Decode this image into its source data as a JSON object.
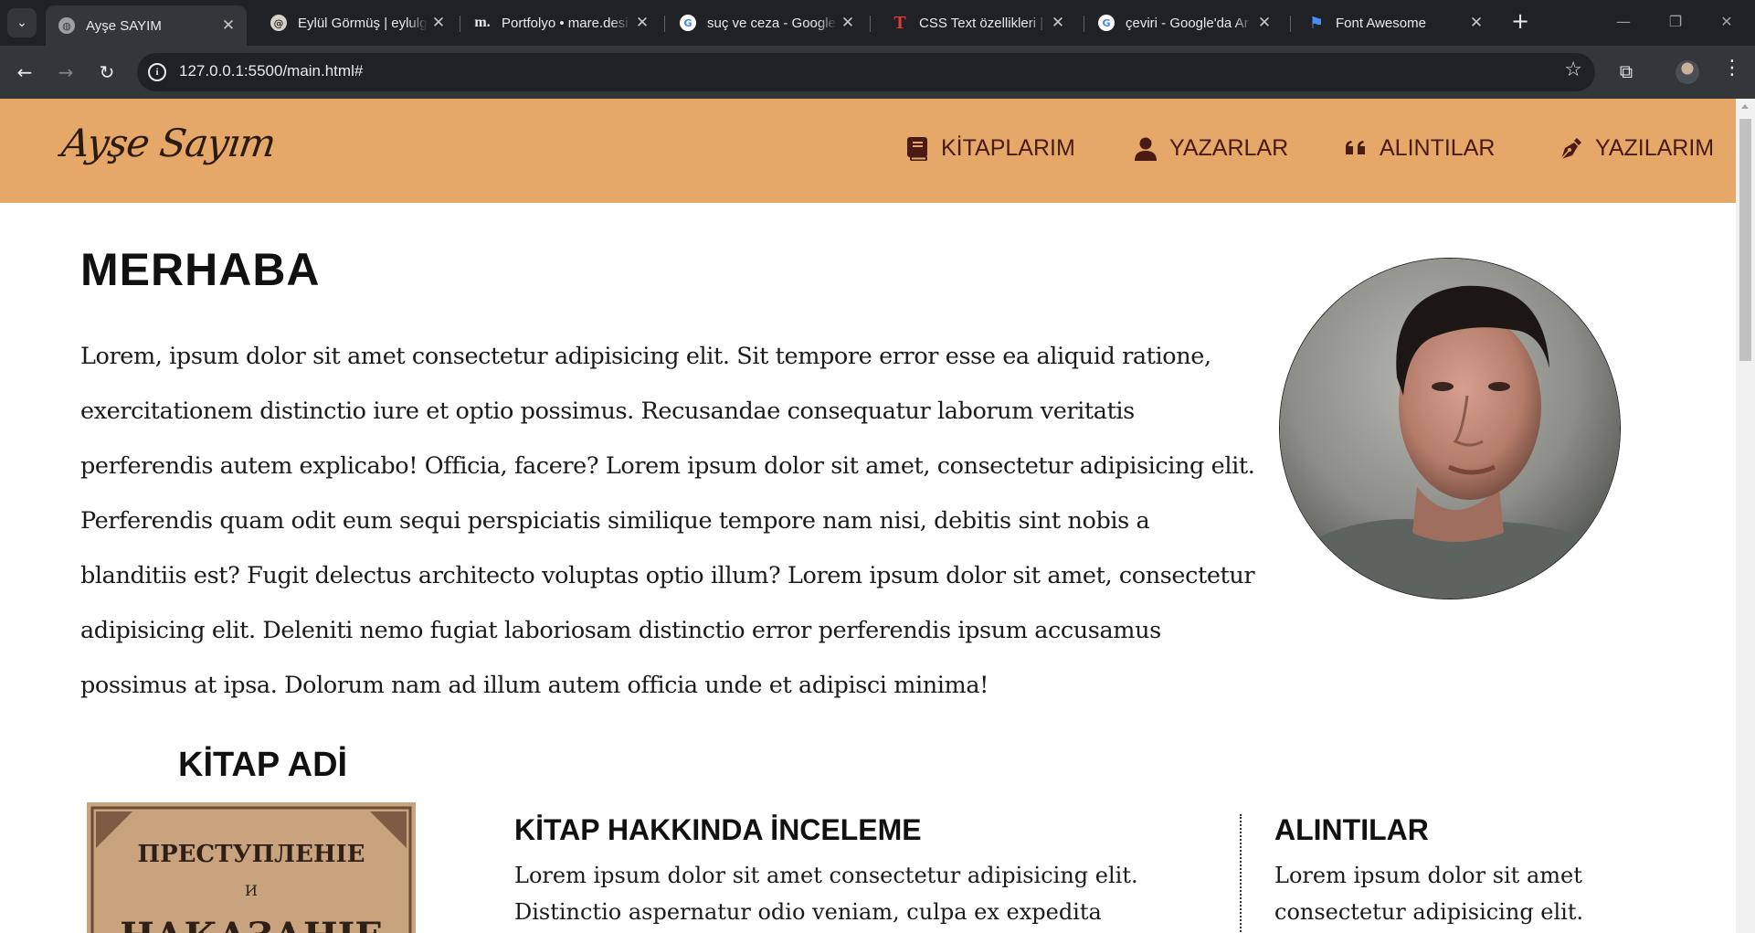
{
  "browser": {
    "tabs": [
      {
        "title": "Ayşe SAYIM",
        "favicon": "globe-icon",
        "active": true
      },
      {
        "title": "Eylül Görmüş | eylulg",
        "favicon": "site-icon"
      },
      {
        "title": "Portfolyo • mare.desi",
        "favicon": "m-icon"
      },
      {
        "title": "suç ve ceza - Google",
        "favicon": "google-icon"
      },
      {
        "title": "CSS Text özellikleri | C",
        "favicon": "t-icon"
      },
      {
        "title": "çeviri - Google'da Ar",
        "favicon": "google-icon"
      },
      {
        "title": "Font Awesome",
        "favicon": "flag-icon"
      }
    ],
    "url": "127.0.0.1:5500/main.html#"
  },
  "site": {
    "logo": "Ayşe Sayım",
    "nav": [
      {
        "label": "KİTAPLARIM",
        "icon": "book-icon"
      },
      {
        "label": "YAZARLAR",
        "icon": "user-icon"
      },
      {
        "label": "ALINTILAR",
        "icon": "quote-icon"
      },
      {
        "label": "YAZILARIM",
        "icon": "pen-icon"
      }
    ],
    "colors": {
      "header": "#e5a868",
      "nav_text": "#4a1a14"
    }
  },
  "intro": {
    "heading": "MERHABA",
    "text": "Lorem, ipsum dolor sit amet consectetur adipisicing elit. Sit tempore error esse ea aliquid ratione, exercitationem distinctio iure et optio possimus. Recusandae consequatur laborum veritatis perferendis autem explicabo! Officia, facere? Lorem ipsum dolor sit amet, consectetur adipisicing elit. Perferendis quam odit eum sequi perspiciatis similique tempore nam nisi, debitis sint nobis a blanditiis est? Fugit delectus architecto voluptas optio illum? Lorem ipsum dolor sit amet, consectetur adipisicing elit. Deleniti nemo fugiat laboriosam distinctio error perferendis ipsum accusamus possimus at ipsa. Dolorum nam ad illum autem officia unde et adipisci minima!"
  },
  "book": {
    "title": "KİTAP ADİ",
    "cover_text": [
      "ПРЕСТУПЛЕНІЕ",
      "И",
      "НАКАЗАНІЕ"
    ],
    "review_heading": "KİTAP HAKKINDA İNCELEME",
    "review_text": "Lorem ipsum dolor sit amet consectetur adipisicing elit. Distinctio aspernatur odio veniam, culpa ex expedita voluptatem eaque nesciunt sit",
    "quotes_heading": "ALINTILAR",
    "quotes_text": "Lorem ipsum dolor sit amet consectetur adipisicing elit. Praesentium,"
  }
}
